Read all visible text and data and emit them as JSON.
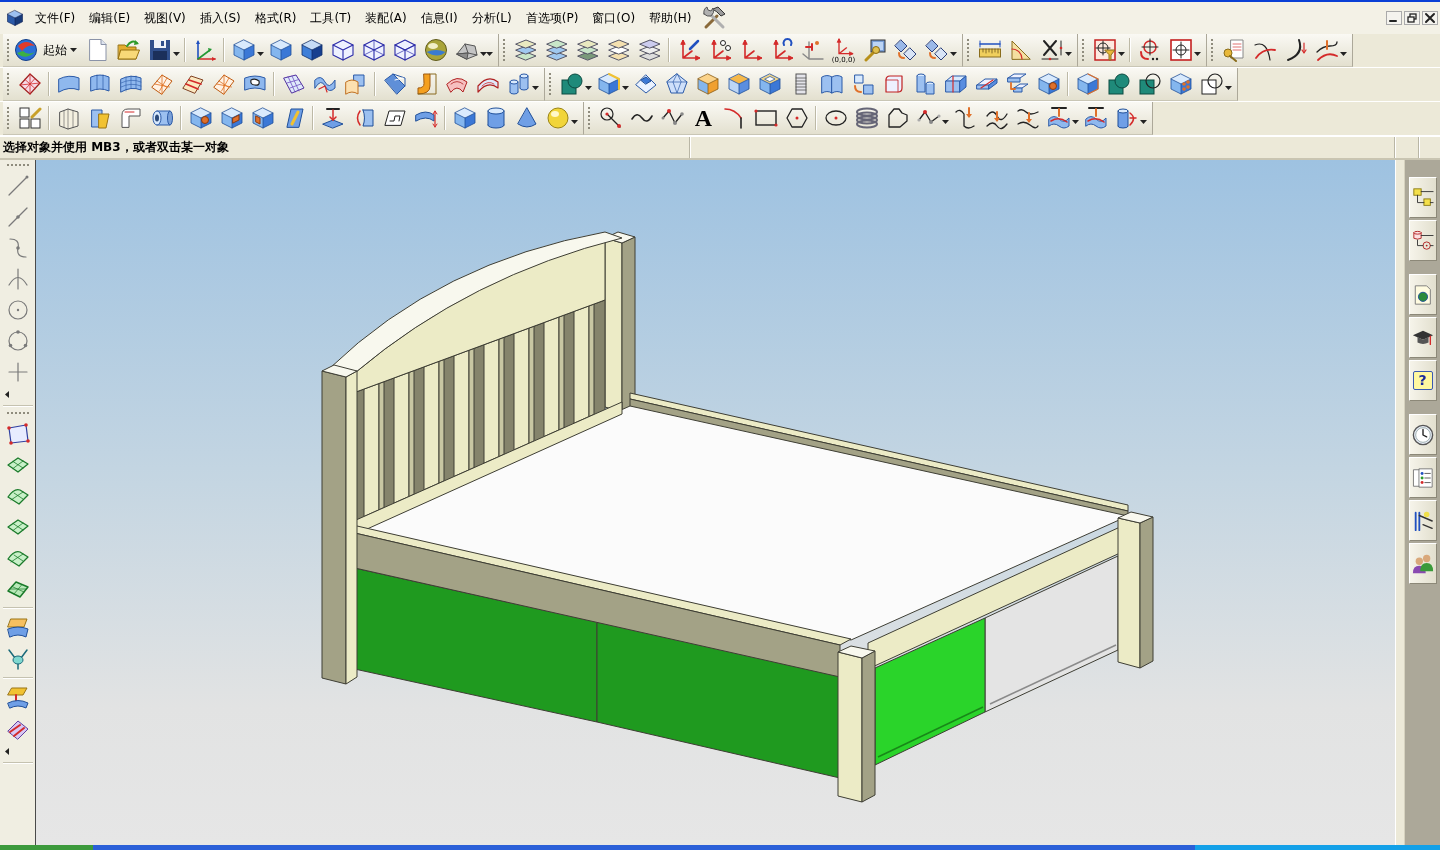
{
  "menu_bar": {
    "items": [
      {
        "label": "文件(F)"
      },
      {
        "label": "编辑(E)"
      },
      {
        "label": "视图(V)"
      },
      {
        "label": "插入(S)"
      },
      {
        "label": "格式(R)"
      },
      {
        "label": "工具(T)"
      },
      {
        "label": "装配(A)"
      },
      {
        "label": "信息(I)"
      },
      {
        "label": "分析(L)"
      },
      {
        "label": "首选项(P)"
      },
      {
        "label": "窗口(O)"
      },
      {
        "label": "帮助(H)"
      }
    ]
  },
  "toolbar": {
    "start_button": {
      "label": "起始"
    },
    "origin_tool": {
      "label": "(0,0,0)"
    },
    "text_tool": {
      "label": "A"
    }
  },
  "prompt": {
    "text": "选择对象并使用 MB3，或者双击某一对象"
  },
  "resource_bar": {
    "help_tab": {
      "label": "?"
    }
  }
}
